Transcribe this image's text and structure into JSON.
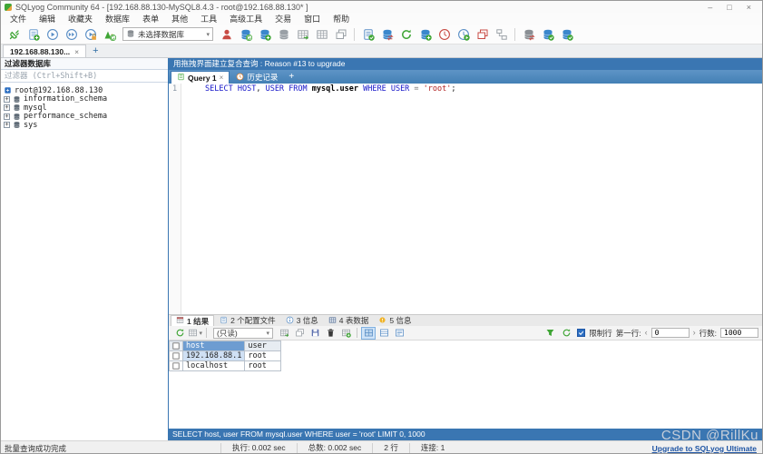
{
  "window": {
    "title": "SQLyog Community 64 - [192.168.88.130-MySQL8.4.3 - root@192.168.88.130* ]",
    "minimize": "–",
    "maximize": "□",
    "close": "×"
  },
  "menu_items": [
    "文件",
    "编辑",
    "收藏夹",
    "数据库",
    "表单",
    "其他",
    "工具",
    "高级工具",
    "交易",
    "窗口",
    "帮助"
  ],
  "toolbar": {
    "db_selector_value": "未选择数据库",
    "items": [
      {
        "name": "new-connection-icon",
        "kind": "plug",
        "color": "#3fa535"
      },
      {
        "name": "new-query-editor-icon",
        "kind": "doc",
        "color": "#6f9fd0",
        "badge": "plus"
      },
      {
        "name": "execute-query-icon",
        "kind": "play",
        "color": "#5b8fc6"
      },
      {
        "name": "execute-all-queries-icon",
        "kind": "ffplay",
        "color": "#5b8fc6"
      },
      {
        "name": "explain-query-icon",
        "kind": "play",
        "color": "#5b8fc6",
        "badge": "lock"
      },
      {
        "name": "format-queries-icon",
        "kind": "mountain",
        "color": "#3fa535",
        "badge": "refresh"
      },
      {
        "type": "select",
        "name": "database-selector"
      },
      {
        "name": "user-manager-icon",
        "kind": "person",
        "color": "#c84b44"
      },
      {
        "name": "create-database-icon",
        "kind": "db",
        "color": "#3a87cc",
        "badge": "refresh"
      },
      {
        "name": "alter-database-icon",
        "kind": "db",
        "color": "#3a87cc",
        "badge": "plus"
      },
      {
        "name": "backup-database-icon",
        "kind": "db",
        "color": "#9aa0a6"
      },
      {
        "name": "import-external-data-icon",
        "kind": "grid",
        "color": "#9aa0a6",
        "badge": "arrow"
      },
      {
        "name": "export-table-data-icon",
        "kind": "grid",
        "color": "#9aa0a6"
      },
      {
        "name": "open-multi-window-icon",
        "kind": "windows",
        "color": "#9aa0a6"
      },
      {
        "type": "sep"
      },
      {
        "name": "query-builder-icon",
        "kind": "doc",
        "color": "#5b8fc6",
        "badge": "check"
      },
      {
        "name": "db-sync-icon",
        "kind": "db",
        "color": "#3a87cc",
        "badge": "sync"
      },
      {
        "name": "refresh-object-browser-icon",
        "kind": "refresh",
        "color": "#3fa535"
      },
      {
        "name": "add-database-icon",
        "kind": "db",
        "color": "#3a87cc",
        "badge": "plus"
      },
      {
        "name": "query-profiler-icon",
        "kind": "clock",
        "color": "#c84b44"
      },
      {
        "name": "scheduled-backup-icon",
        "kind": "clock",
        "color": "#5b8fc6",
        "badge": "playb"
      },
      {
        "name": "visual-data-compare-icon",
        "kind": "windows",
        "color": "#c84b44"
      },
      {
        "name": "schema-designer-icon",
        "kind": "designer",
        "color": "#9aa0a6"
      },
      {
        "type": "sep"
      },
      {
        "name": "structure-sync-icon",
        "kind": "db",
        "color": "#8a8f94",
        "badge": "sync"
      },
      {
        "name": "data-sync-icon",
        "kind": "db",
        "color": "#3a87cc",
        "badge": "check"
      },
      {
        "name": "job-agent-icon",
        "kind": "db",
        "color": "#3a87cc",
        "badge": "check"
      }
    ]
  },
  "connection_tabs": {
    "active_label": "192.168.88.130...",
    "close_glyph": "×",
    "new_tab_glyph": "+"
  },
  "sidebar": {
    "header": "过滤器数据库",
    "filter_placeholder": "过滤器 (Ctrl+Shift+B)",
    "tree": [
      {
        "label": "root@192.168.88.130",
        "type": "connection"
      },
      {
        "label": "information_schema",
        "type": "database"
      },
      {
        "label": "mysql",
        "type": "database"
      },
      {
        "label": "performance_schema",
        "type": "database"
      },
      {
        "label": "sys",
        "type": "database"
      }
    ]
  },
  "promo_bar": {
    "text": "用拖拽界面建立复合查询 : Reason #13 to upgrade"
  },
  "query_tabs": {
    "tabs": [
      {
        "label": "Query 1",
        "active": true,
        "icon": "query-doc-icon",
        "kind": "doc",
        "color": "#3fa535",
        "close": "×"
      },
      {
        "label": "历史记录",
        "active": false,
        "icon": "history-icon",
        "kind": "clock",
        "color": "#d87d2e"
      }
    ],
    "new_tab_glyph": "+"
  },
  "editor": {
    "line_number": "1",
    "tokens": [
      {
        "text": "SELECT",
        "type": "keyword"
      },
      {
        "text": " ",
        "type": "plain"
      },
      {
        "text": "HOST",
        "type": "keyword"
      },
      {
        "text": ", ",
        "type": "plain"
      },
      {
        "text": "USER",
        "type": "keyword"
      },
      {
        "text": " ",
        "type": "plain"
      },
      {
        "text": "FROM",
        "type": "keyword"
      },
      {
        "text": " ",
        "type": "plain"
      },
      {
        "text": "mysql.user",
        "type": "identifier"
      },
      {
        "text": " ",
        "type": "plain"
      },
      {
        "text": "WHERE",
        "type": "keyword"
      },
      {
        "text": " ",
        "type": "plain"
      },
      {
        "text": "USER",
        "type": "keyword"
      },
      {
        "text": " = ",
        "type": "operator"
      },
      {
        "text": "'root'",
        "type": "string"
      },
      {
        "text": ";",
        "type": "plain"
      }
    ]
  },
  "result_tabs": [
    {
      "label": "1 结果",
      "icon": "result-grid-icon",
      "kind": "tablegrid",
      "color": "#c0504d",
      "active": true
    },
    {
      "label": "2 个配置文件",
      "icon": "profiler-icon",
      "kind": "doc",
      "color": "#5b8fc6",
      "active": false
    },
    {
      "label": "3 信息",
      "icon": "info-icon",
      "kind": "infocircle",
      "color": "#5b8fc6",
      "active": false
    },
    {
      "label": "4 表数据",
      "icon": "table-data-icon",
      "kind": "grid",
      "color": "#44618c",
      "active": false
    },
    {
      "label": "5 信息",
      "icon": "warning-icon",
      "kind": "warndot",
      "color": "#f0b429",
      "active": false
    }
  ],
  "result_toolbar": {
    "mode_value": "(只读)",
    "limit_rows_label": "限制行",
    "first_row_label": "第一行:",
    "first_row_value": "0",
    "row_count_label": "行数:",
    "row_count_value": "1000",
    "left_items": [
      {
        "name": "refresh-grid-icon",
        "kind": "refresh",
        "color": "#3fa535"
      },
      {
        "name": "grid-options-icon",
        "kind": "grid",
        "color": "#9aa0a6",
        "caret": true
      },
      {
        "type": "sep"
      },
      {
        "type": "mode-select",
        "name": "edit-mode-selector"
      },
      {
        "name": "export-data-icon",
        "kind": "grid",
        "color": "#9aa0a6",
        "badge": "arrow"
      },
      {
        "name": "copy-row-icon",
        "kind": "windows",
        "color": "#9aa0a6"
      },
      {
        "name": "save-changes-icon",
        "kind": "floppy",
        "color": "#5b6fae"
      },
      {
        "name": "delete-row-icon",
        "kind": "trash",
        "color": "#3a3a3a"
      },
      {
        "name": "insert-row-icon",
        "kind": "grid",
        "color": "#9aa0a6",
        "badge": "plus"
      },
      {
        "type": "sep"
      },
      {
        "name": "grid-view-icon",
        "kind": "viewgrid",
        "color": "#5b8fc6",
        "active": true
      },
      {
        "name": "form-view-icon",
        "kind": "viewform",
        "color": "#5b8fc6"
      },
      {
        "name": "text-view-icon",
        "kind": "viewtext",
        "color": "#5b8fc6"
      }
    ],
    "right_items": [
      {
        "name": "filter-rows-icon",
        "kind": "funnel",
        "color": "#3fa535"
      },
      {
        "name": "apply-limit-icon",
        "kind": "refresh",
        "color": "#3fa535"
      }
    ]
  },
  "result_grid": {
    "columns": [
      "host",
      "user"
    ],
    "rows": [
      [
        "192.168.88.1",
        "root"
      ],
      [
        "localhost",
        "root"
      ]
    ],
    "selected_column": "host",
    "selected_cell": "192.168.88.1"
  },
  "message_bar": {
    "text": "SELECT host, user FROM mysql.user WHERE user = 'root' LIMIT 0, 1000"
  },
  "status_bar": {
    "message": "批量查询成功完成",
    "exec_label": "执行:",
    "exec_value": "0.002 sec",
    "total_label": "总数:",
    "total_value": "0.002 sec",
    "row_count": "2 行",
    "conn_label": "连接:",
    "conn_value": "1",
    "upgrade_link": "Upgrade to SQLyog Ultimate"
  },
  "watermark": "CSDN @RillKu"
}
